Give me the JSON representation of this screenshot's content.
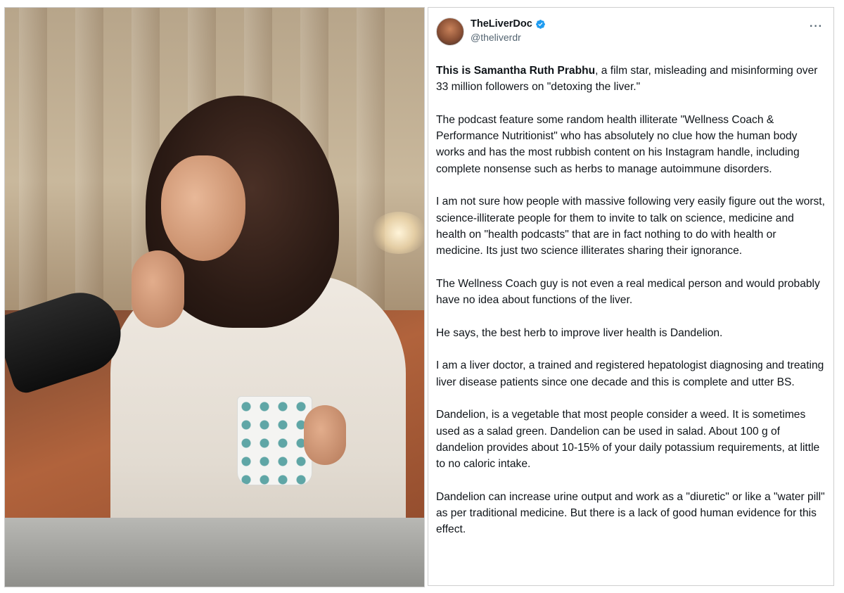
{
  "photo": {
    "description_icon": "podcast-photo"
  },
  "tweet": {
    "author": {
      "display_name": "TheLiverDoc",
      "handle": "@theliverdr",
      "verified_color": "#1d9bf0"
    },
    "more_label": "···",
    "paragraphs": [
      {
        "bold_lead": "This is Samantha Ruth Prabhu",
        "text": ", a film star, misleading and misinforming over 33 million followers on \"detoxing the liver.\""
      },
      {
        "bold_lead": "",
        "text": "The podcast feature some random health illiterate \"Wellness Coach & Performance Nutritionist\" who has absolutely no clue how the human body works and has the most rubbish content on his Instagram handle, including complete nonsense such as herbs to manage autoimmune disorders."
      },
      {
        "bold_lead": "",
        "text": "I am not sure how people with massive following very easily figure out the worst, science-illiterate people for them to invite to talk on science, medicine and health on \"health podcasts\" that are in fact nothing to do with health or medicine. Its just two science illiterates sharing their ignorance."
      },
      {
        "bold_lead": "",
        "text": "The Wellness Coach guy is not even a real medical person and would probably have no idea about functions of the liver."
      },
      {
        "bold_lead": "",
        "text": "He says, the best herb to improve liver health is Dandelion."
      },
      {
        "bold_lead": "",
        "text": "I am a liver doctor, a trained and registered hepatologist diagnosing and treating liver disease patients since one decade and this is complete and utter BS."
      },
      {
        "bold_lead": "",
        "text": "Dandelion, is a vegetable that most people consider a weed. It is sometimes used as a salad green. Dandelion can be used in salad. About 100 g of dandelion provides about 10-15% of your daily potassium requirements, at little to no caloric intake."
      },
      {
        "bold_lead": "",
        "text": "Dandelion can increase urine output and work as a \"diuretic\" or like a \"water pill\" as per traditional medicine. But there is a lack of good human evidence for this effect."
      }
    ]
  }
}
